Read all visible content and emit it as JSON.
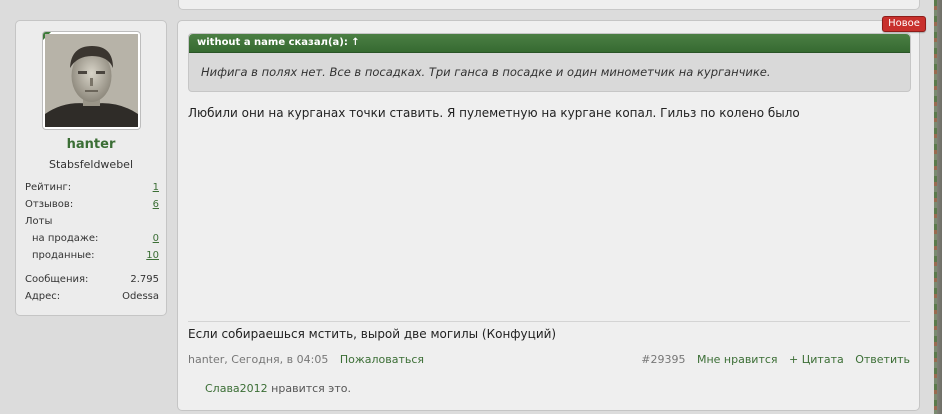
{
  "user": {
    "name": "hanter",
    "title": "Stabsfeldwebel",
    "stats": [
      {
        "label": "Рейтинг:",
        "value": "1",
        "link": true,
        "indent": false
      },
      {
        "label": "Отзывов:",
        "value": "6",
        "link": true,
        "indent": false
      },
      {
        "label": "Лоты",
        "value": "",
        "link": false,
        "indent": false
      },
      {
        "label": "на продаже:",
        "value": "0",
        "link": true,
        "indent": true
      },
      {
        "label": "проданные:",
        "value": "10",
        "link": true,
        "indent": true
      }
    ],
    "stats2": [
      {
        "label": "Сообщения:",
        "value": "2.795"
      },
      {
        "label": "Адрес:",
        "value": "Odessa"
      }
    ]
  },
  "post": {
    "badge": "Новое",
    "quote": {
      "author_line": "without a name сказал(а): ↑",
      "text": "Нифига в полях нет. Все в посадках. Три ганса в посадке и один минометчик на курганчике."
    },
    "body": "Любили они на курганах точки ставить. Я пулеметную на кургане копал. Гильз по колено было",
    "signature": "Если собираешься мстить, вырой две могилы (Конфуций)",
    "meta": {
      "author_time": "hanter, Сегодня, в 04:05",
      "report": "Пожаловаться",
      "post_number": "#29395",
      "like": "Мне нравится",
      "quote": "+ Цитата",
      "reply": "Ответить"
    },
    "likes": {
      "liker": "Слава2012",
      "suffix": " нравится это."
    }
  },
  "colors": {
    "accent_green": "#3b6e35",
    "badge_red": "#c8302c",
    "quote_header": "#3d7338"
  }
}
